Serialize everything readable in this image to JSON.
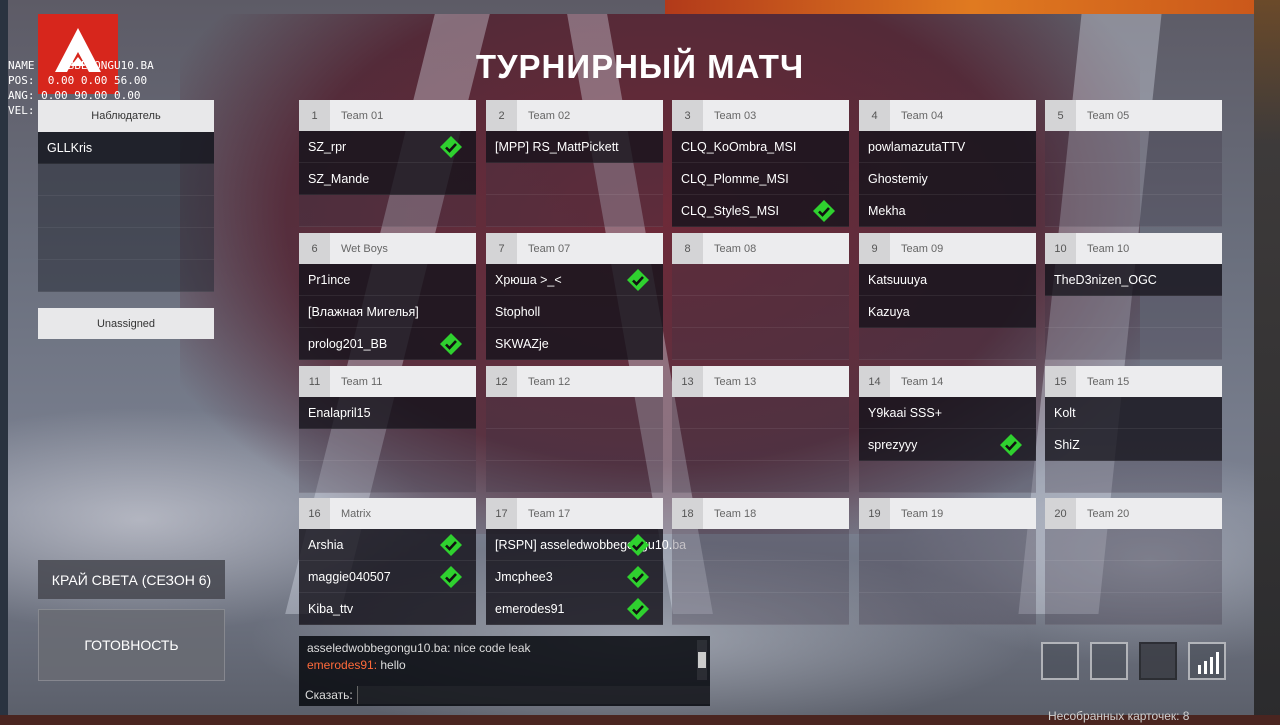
{
  "title": "ТУРНИРНЫЙ МАТЧ",
  "debug_lines": [
    "NAME    OBBEGONGU10.BA",
    "POS:  0.00 0.00 56.00",
    "ANG: 0.00 90.00 0.00",
    "VEL:  0.00"
  ],
  "observers": {
    "header": "Наблюдатель",
    "slots": [
      "GLLKris",
      "",
      "",
      "",
      ""
    ]
  },
  "unassigned": "Unassigned",
  "teams": [
    {
      "num": "1",
      "name": "Team 01",
      "players": [
        {
          "name": "SZ_rpr",
          "ready": true
        },
        {
          "name": "SZ_Mande",
          "ready": false
        },
        {
          "name": "",
          "ready": false
        }
      ]
    },
    {
      "num": "2",
      "name": "Team 02",
      "players": [
        {
          "name": "[MPP] RS_MattPickett",
          "ready": false
        },
        {
          "name": "",
          "ready": false
        },
        {
          "name": "",
          "ready": false
        }
      ]
    },
    {
      "num": "3",
      "name": "Team 03",
      "players": [
        {
          "name": "CLQ_KoOmbra_MSI",
          "ready": false
        },
        {
          "name": "CLQ_Plomme_MSI",
          "ready": false
        },
        {
          "name": "CLQ_StyleS_MSI",
          "ready": true
        }
      ]
    },
    {
      "num": "4",
      "name": "Team 04",
      "players": [
        {
          "name": "powlamazutaTTV",
          "ready": false
        },
        {
          "name": "Ghostemiy",
          "ready": false
        },
        {
          "name": "Mekha",
          "ready": false
        }
      ]
    },
    {
      "num": "5",
      "name": "Team 05",
      "players": [
        {
          "name": "",
          "ready": false
        },
        {
          "name": "",
          "ready": false
        },
        {
          "name": "",
          "ready": false
        }
      ]
    },
    {
      "num": "6",
      "name": "Wet Boys",
      "players": [
        {
          "name": "Pr1ince",
          "ready": false
        },
        {
          "name": "[Влажная Мигелья]",
          "ready": false
        },
        {
          "name": "prolog201_BB",
          "ready": true
        }
      ]
    },
    {
      "num": "7",
      "name": "Team 07",
      "players": [
        {
          "name": "Хрюша >_<",
          "ready": true
        },
        {
          "name": "Stopholl",
          "ready": false
        },
        {
          "name": "SKWAZje",
          "ready": false
        }
      ]
    },
    {
      "num": "8",
      "name": "Team 08",
      "players": [
        {
          "name": "",
          "ready": false
        },
        {
          "name": "",
          "ready": false
        },
        {
          "name": "",
          "ready": false
        }
      ]
    },
    {
      "num": "9",
      "name": "Team 09",
      "players": [
        {
          "name": "Katsuuuya",
          "ready": false
        },
        {
          "name": "Kazuya",
          "ready": false
        },
        {
          "name": "",
          "ready": false
        }
      ]
    },
    {
      "num": "10",
      "name": "Team 10",
      "players": [
        {
          "name": "TheD3nizen_OGC",
          "ready": false
        },
        {
          "name": "",
          "ready": false
        },
        {
          "name": "",
          "ready": false
        }
      ]
    },
    {
      "num": "11",
      "name": "Team 11",
      "players": [
        {
          "name": "Enalapril15",
          "ready": false
        },
        {
          "name": "",
          "ready": false
        },
        {
          "name": "",
          "ready": false
        }
      ]
    },
    {
      "num": "12",
      "name": "Team 12",
      "players": [
        {
          "name": "",
          "ready": false
        },
        {
          "name": "",
          "ready": false
        },
        {
          "name": "",
          "ready": false
        }
      ]
    },
    {
      "num": "13",
      "name": "Team 13",
      "players": [
        {
          "name": "",
          "ready": false
        },
        {
          "name": "",
          "ready": false
        },
        {
          "name": "",
          "ready": false
        }
      ]
    },
    {
      "num": "14",
      "name": "Team 14",
      "players": [
        {
          "name": "Y9kaai SSS+",
          "ready": false
        },
        {
          "name": "sprezyyy",
          "ready": true
        },
        {
          "name": "",
          "ready": false
        }
      ]
    },
    {
      "num": "15",
      "name": "Team 15",
      "players": [
        {
          "name": "Kolt",
          "ready": false
        },
        {
          "name": "ShiZ",
          "ready": false
        },
        {
          "name": "",
          "ready": false
        }
      ]
    },
    {
      "num": "16",
      "name": "Matrix",
      "players": [
        {
          "name": "Arshia",
          "ready": true
        },
        {
          "name": "maggie040507",
          "ready": true
        },
        {
          "name": "Kiba_ttv",
          "ready": false
        }
      ]
    },
    {
      "num": "17",
      "name": "Team 17",
      "players": [
        {
          "name": "[RSPN] asseledwobbegongu10.ba",
          "ready": true
        },
        {
          "name": "Jmcphee3",
          "ready": true
        },
        {
          "name": "emerodes91",
          "ready": true
        }
      ]
    },
    {
      "num": "18",
      "name": "Team 18",
      "players": [
        {
          "name": "",
          "ready": false
        },
        {
          "name": "",
          "ready": false
        },
        {
          "name": "",
          "ready": false
        }
      ]
    },
    {
      "num": "19",
      "name": "Team 19",
      "players": [
        {
          "name": "",
          "ready": false
        },
        {
          "name": "",
          "ready": false
        },
        {
          "name": "",
          "ready": false
        }
      ]
    },
    {
      "num": "20",
      "name": "Team 20",
      "players": [
        {
          "name": "",
          "ready": false
        },
        {
          "name": "",
          "ready": false
        },
        {
          "name": "",
          "ready": false
        }
      ]
    }
  ],
  "buttons": {
    "season": "КРАЙ СВЕТА (СЕЗОН 6)",
    "ready": "ГОТОВНОСТЬ"
  },
  "chat": {
    "messages": [
      {
        "user": "",
        "text": "asseledwobbegongu10.ba: nice code leak"
      },
      {
        "user": "emerodes91:",
        "text": " hello"
      }
    ],
    "input_label": "Сказать:"
  },
  "bottom_note": "Несобранных карточек: 8",
  "colors": {
    "ready_check": "#2fd12f",
    "logo_red": "#d7261c",
    "chat_name": "#ff6a3a"
  }
}
